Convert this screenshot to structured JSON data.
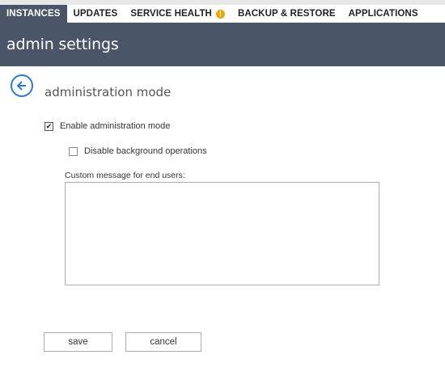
{
  "tabs": [
    {
      "label": "INSTANCES",
      "active": true
    },
    {
      "label": "UPDATES",
      "active": false
    },
    {
      "label": "SERVICE HEALTH",
      "active": false,
      "badge_icon": "warning-icon",
      "badge_text": "!"
    },
    {
      "label": "BACKUP & RESTORE",
      "active": false
    },
    {
      "label": "APPLICATIONS",
      "active": false
    }
  ],
  "header": {
    "title": "admin settings"
  },
  "page": {
    "back_icon": "back-arrow-icon",
    "section_title": "administration mode"
  },
  "options": {
    "enable_admin_mode": {
      "label": "Enable administration mode",
      "checked": true
    },
    "disable_background": {
      "label": "Disable background operations",
      "checked": false
    }
  },
  "message": {
    "label": "Custom message for end users:",
    "value": ""
  },
  "buttons": {
    "save": "save",
    "cancel": "cancel"
  },
  "colors": {
    "header_bg": "#4a5568",
    "accent_blue": "#2a7ad2",
    "warning_orange": "#f0a30a",
    "highlight_yellow": "#f4f200"
  }
}
